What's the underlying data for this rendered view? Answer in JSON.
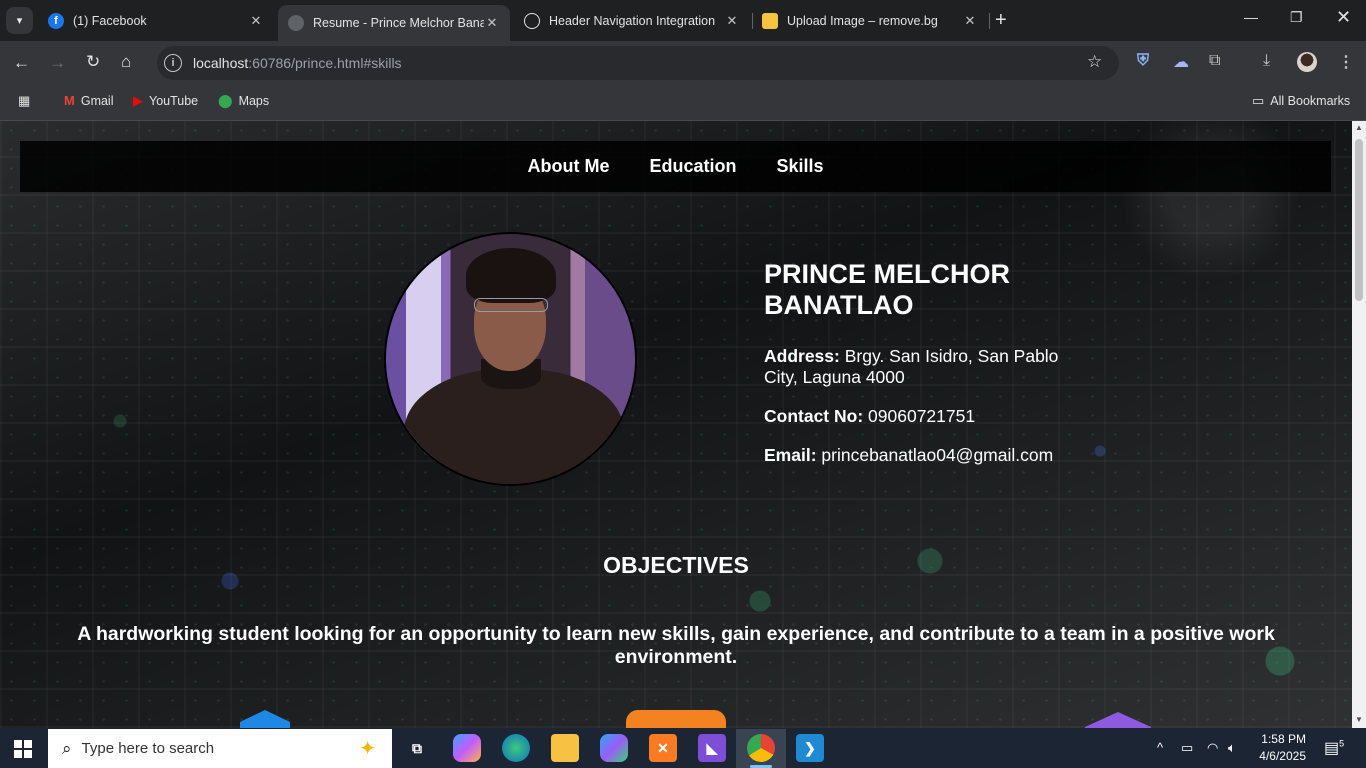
{
  "browser": {
    "tabs": [
      {
        "label": "(1) Facebook",
        "icon": "facebook-icon",
        "active": false
      },
      {
        "label": "Resume - Prince Melchor Banatlao",
        "icon": "globe-icon",
        "active": true
      },
      {
        "label": "Header Navigation Integration",
        "icon": "openai-icon",
        "active": false
      },
      {
        "label": "Upload Image – remove.bg",
        "icon": "removebg-icon",
        "active": false
      }
    ],
    "url_host": "localhost",
    "url_rest": ":60786/prince.html#skills",
    "bookmarks": [
      "Gmail",
      "YouTube",
      "Maps"
    ],
    "all_bookmarks": "All Bookmarks"
  },
  "page": {
    "nav": [
      "About Me",
      "Education",
      "Skills"
    ],
    "name": "PRINCE MELCHOR BANATLAO",
    "address_label": "Address:",
    "address": "Brgy. San Isidro, San Pablo City, Laguna 4000",
    "contact_label": "Contact No:",
    "contact": "09060721751",
    "email_label": "Email:",
    "email": "princebanatlao04@gmail.com",
    "objectives_title": "OBJECTIVES",
    "objectives_text": "A hardworking student looking for an opportunity to learn new skills, gain experience, and contribute to a team in a positive work environment."
  },
  "taskbar": {
    "search_placeholder": "Type here to search",
    "time": "1:58 PM",
    "date": "4/6/2025",
    "notifications": "5"
  },
  "colors": {
    "accent_orange": "#f58220",
    "accent_blue": "#1e88e5",
    "accent_purple": "#8e5be0"
  }
}
